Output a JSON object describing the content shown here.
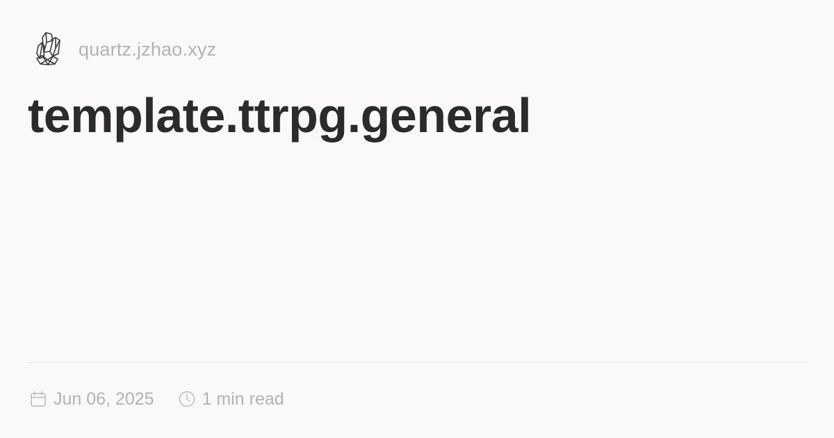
{
  "site": {
    "logo_icon": "crystal-logo-icon",
    "name": "quartz.jzhao.xyz"
  },
  "page": {
    "title": "template.ttrpg.general"
  },
  "meta": {
    "date_icon": "calendar-icon",
    "date": "Jun 06, 2025",
    "reading_time_icon": "clock-icon",
    "reading_time": "1 min read"
  },
  "colors": {
    "background": "#faf8f8",
    "title": "#2b2b2b",
    "muted": "#b3b3b3",
    "divider": "#e6e4e4"
  }
}
